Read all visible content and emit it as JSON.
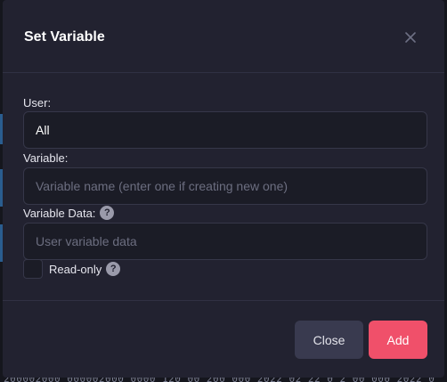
{
  "modal": {
    "title": "Set Variable",
    "close_icon": "close-icon"
  },
  "fields": {
    "user": {
      "label": "User:",
      "value": "All"
    },
    "variable": {
      "label": "Variable:",
      "value": "",
      "placeholder": "Variable name (enter one if creating new one)"
    },
    "variable_data": {
      "label": "Variable Data:",
      "value": "",
      "placeholder": "User variable data",
      "help_icon": "question-circle-icon",
      "help_glyph": "?"
    },
    "read_only": {
      "label": "Read-only",
      "checked": false,
      "help_icon": "question-circle-icon",
      "help_glyph": "?"
    }
  },
  "buttons": {
    "close_label": "Close",
    "add_label": "Add"
  },
  "background": {
    "partial_text": "200002000 000002000 0000 120 00 200 000 2022 02 22 0 2 00 000 2022 0"
  },
  "colors": {
    "modal_bg": "#222230",
    "input_bg": "#1b1c26",
    "primary": "#f0506a",
    "secondary": "#393a4f"
  }
}
